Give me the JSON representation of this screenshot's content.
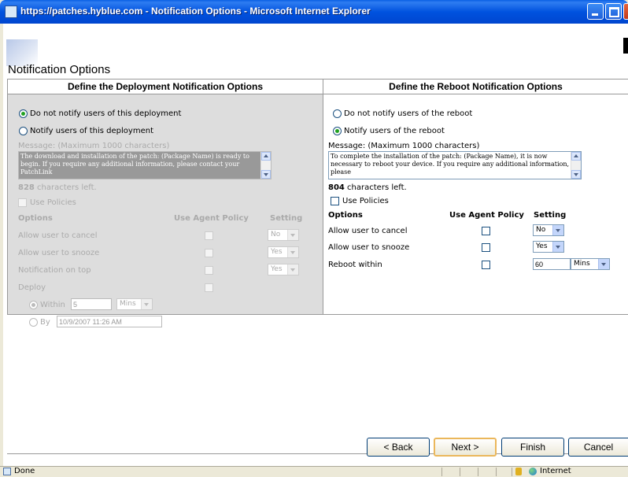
{
  "window": {
    "title": "https://patches.hyblue.com - Notification Options - Microsoft Internet Explorer"
  },
  "page": {
    "title": "Notification Options"
  },
  "deployment": {
    "header": "Define the Deployment Notification Options",
    "radio_no_notify": "Do not notify users of this deployment",
    "radio_notify": "Notify users of this deployment",
    "selected": "no_notify",
    "message_label": "Message: (Maximum 1000 characters)",
    "message_text": "The download and installation of the patch: (Package Name) is ready to begin. If you require any additional information, please contact your PatchLink",
    "chars_left_count": "828",
    "chars_left_suffix": " characters left.",
    "use_policies_label": "Use Policies",
    "col_options": "Options",
    "col_use_agent_policy": "Use Agent Policy",
    "col_setting": "Setting",
    "options": [
      {
        "label": "Allow user to cancel",
        "setting": "No"
      },
      {
        "label": "Allow user to snooze",
        "setting": "Yes"
      },
      {
        "label": "Notification on top",
        "setting": "Yes"
      },
      {
        "label": "Deploy",
        "setting": ""
      }
    ],
    "within_label": "Within",
    "within_value": "5",
    "within_unit": "Mins",
    "by_label": "By",
    "by_value": "10/9/2007 11:26 AM"
  },
  "reboot": {
    "header": "Define the Reboot Notification Options",
    "radio_no_notify": "Do not notify users of the reboot",
    "radio_notify": "Notify users of the reboot",
    "selected": "notify",
    "message_label": "Message: (Maximum 1000 characters)",
    "message_text": "To complete the installation of the patch: (Package Name), it is now necessary to reboot your device. If you require any additional information, please",
    "chars_left_count": "804",
    "chars_left_suffix": " characters left.",
    "use_policies_label": "Use Policies",
    "col_options": "Options",
    "col_use_agent_policy": "Use Agent Policy",
    "col_setting": "Setting",
    "options": [
      {
        "label": "Allow user to cancel",
        "setting": "No"
      },
      {
        "label": "Allow user to snooze",
        "setting": "Yes"
      },
      {
        "label": "Reboot within",
        "setting": "60",
        "unit": "Mins"
      }
    ]
  },
  "buttons": {
    "back": "< Back",
    "next": "Next >",
    "finish": "Finish",
    "cancel": "Cancel"
  },
  "statusbar": {
    "status": "Done",
    "zone": "Internet"
  }
}
